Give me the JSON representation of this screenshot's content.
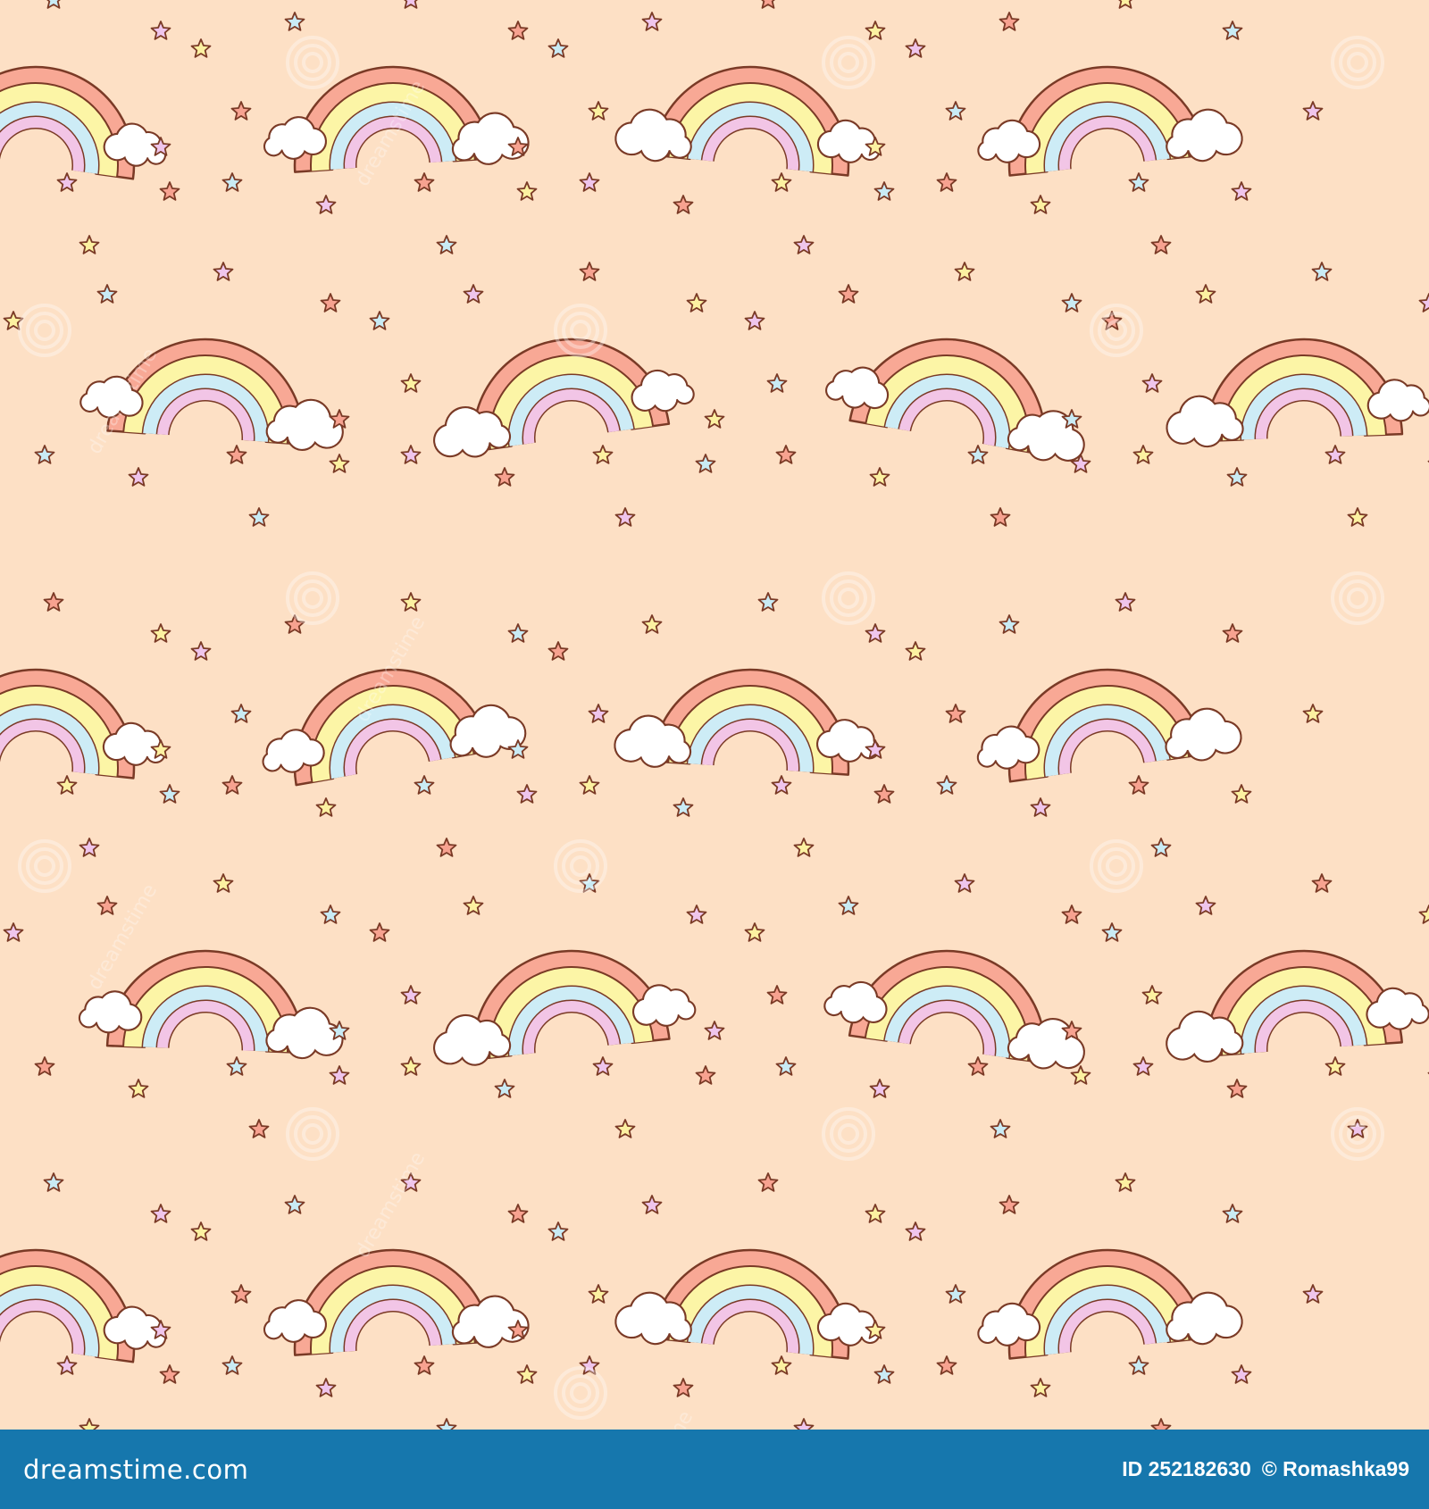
{
  "colors": {
    "background": "#fde0c5",
    "band_outer": "#f8a895",
    "band_yellow": "#fcf5a6",
    "band_blue": "#cdecf6",
    "band_pink": "#f2c5e6",
    "outline": "#7a3a26",
    "cloud": "#ffffff",
    "star_colors": [
      "#f7a290",
      "#fcf1a1",
      "#c9ebf5",
      "#efc5ec"
    ],
    "footer_bar": "#1677ad",
    "footer_text": "#ffffff"
  },
  "pattern": {
    "motif": "rainbow-with-clouds-and-stars",
    "icon": "rainbow-icon",
    "repeat_columns": 4,
    "repeat_rows": 5
  },
  "watermark": {
    "text": "dreamstime",
    "icon": "dreamstime-spiral-icon"
  },
  "footer": {
    "logo_text": "dreamstime.com",
    "id_text": "ID 252182630",
    "copyright_text": "© Romashka99"
  }
}
